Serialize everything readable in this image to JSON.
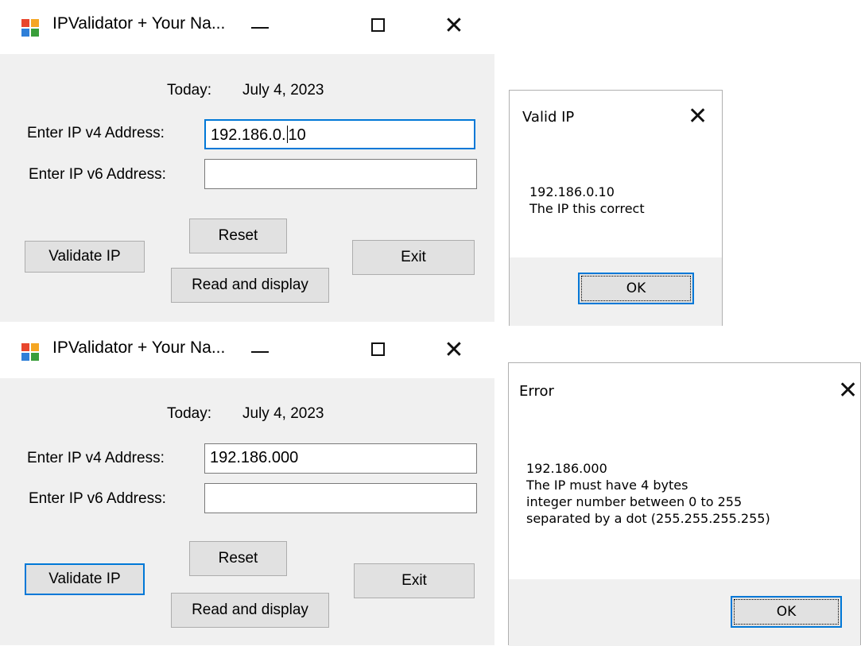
{
  "windows": [
    {
      "title": "IPValidator + Your Na...",
      "today_label": "Today:",
      "today_value": "July 4, 2023",
      "ipv4_label": "Enter IP v4 Address:",
      "ipv4_value_before_caret": "192.186.0.",
      "ipv4_value_after_caret": "10",
      "ipv6_label": "Enter IP v6 Address:",
      "ipv6_value": "",
      "validate_label": "Validate IP",
      "reset_label": "Reset",
      "read_display_label": "Read and display",
      "exit_label": "Exit"
    },
    {
      "title": "IPValidator + Your Na...",
      "today_label": "Today:",
      "today_value": "July 4, 2023",
      "ipv4_label": "Enter IP v4 Address:",
      "ipv4_value": "192.186.000",
      "ipv6_label": "Enter IP v6 Address:",
      "ipv6_value": "",
      "validate_label": "Validate IP",
      "reset_label": "Reset",
      "read_display_label": "Read and display",
      "exit_label": "Exit"
    }
  ],
  "dialogs": [
    {
      "title": "Valid IP",
      "lines": [
        "192.186.0.10",
        "The IP this correct"
      ],
      "ok_label": "OK"
    },
    {
      "title": "Error",
      "lines": [
        "192.186.000",
        "The IP must have 4 bytes",
        "integer number between 0 to 255",
        "separated by a dot (255.255.255.255)"
      ],
      "ok_label": "OK"
    }
  ],
  "icons": {
    "app": "app-window-icon",
    "minimize": "minimize-icon",
    "maximize": "maximize-icon",
    "close": "close-icon"
  },
  "colors": {
    "focus_border": "#0078d7",
    "window_bg": "#f0f0f0",
    "button_bg": "#e1e1e1"
  }
}
